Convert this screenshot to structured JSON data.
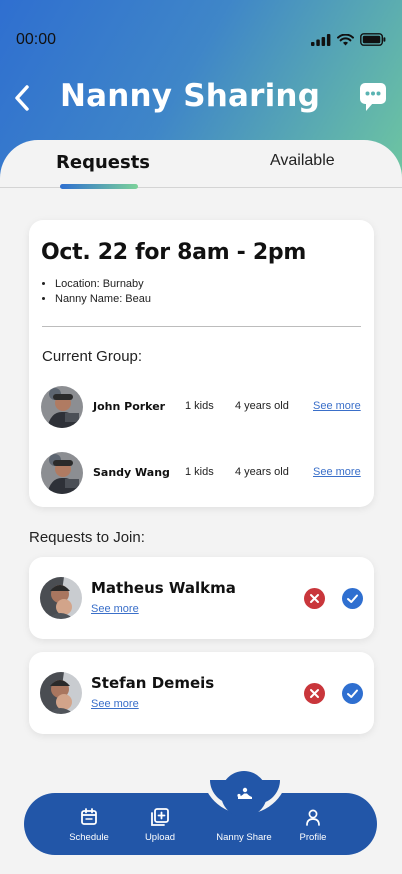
{
  "status": {
    "time": "00:00"
  },
  "header": {
    "title": "Nanny Sharing"
  },
  "tabs": [
    {
      "label": "Requests",
      "active": true
    },
    {
      "label": "Available",
      "active": false
    }
  ],
  "booking": {
    "title": "Oct. 22 for 8am - 2pm",
    "details": [
      "Location: Burnaby",
      "Nanny Name: Beau"
    ],
    "group_label": "Current Group:",
    "members": [
      {
        "name": "John Porker",
        "kids": "1 kids",
        "age": "4 years old",
        "more": "See more"
      },
      {
        "name": "Sandy Wang",
        "kids": "1 kids",
        "age": "4 years old",
        "more": "See more"
      }
    ]
  },
  "join": {
    "label": "Requests to Join:",
    "requests": [
      {
        "name": "Matheus Walkma",
        "more": "See more"
      },
      {
        "name": "Stefan Demeis",
        "more": "See more"
      }
    ]
  },
  "bottom_nav": {
    "items": [
      {
        "label": "Schedule",
        "icon": "calendar-icon"
      },
      {
        "label": "Upload",
        "icon": "add-image-icon"
      },
      {
        "label": "Nanny Share",
        "icon": "nanny-share-icon"
      },
      {
        "label": "Profile",
        "icon": "profile-icon"
      }
    ]
  },
  "colors": {
    "accent": "#2256a8",
    "decline": "#c9363b",
    "accept": "#2f6fd0",
    "link": "#3a6fc9"
  }
}
